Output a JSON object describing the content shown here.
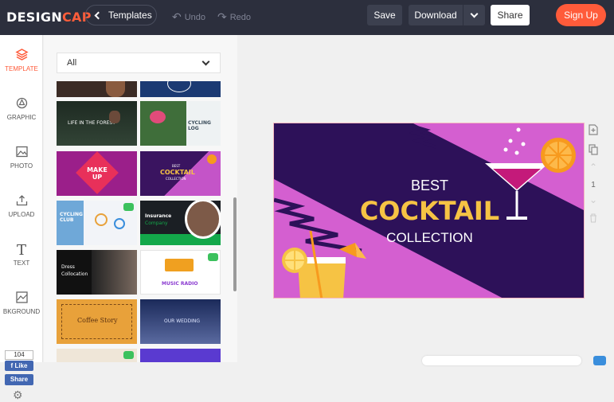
{
  "app": {
    "logo_design": "DESIGN",
    "logo_cap": "CAP"
  },
  "toolbar": {
    "templates_label": "Templates",
    "undo_label": "Undo",
    "redo_label": "Redo",
    "save_label": "Save",
    "download_label": "Download",
    "share_label": "Share",
    "signup_label": "Sign Up"
  },
  "sidebar": {
    "items": [
      {
        "label": "TEMPLATE",
        "icon": "layers-icon",
        "active": true
      },
      {
        "label": "GRAPHIC",
        "icon": "shapes-icon"
      },
      {
        "label": "PHOTO",
        "icon": "image-icon"
      },
      {
        "label": "UPLOAD",
        "icon": "upload-icon"
      },
      {
        "label": "TEXT",
        "icon": "text-icon"
      },
      {
        "label": "BKGROUND",
        "icon": "background-icon"
      }
    ],
    "fb_count": "104",
    "fb_like": "Like",
    "fb_share": "Share"
  },
  "panel": {
    "filter_value": "All",
    "thumbnails": [
      {
        "title": "LIFE IN THE FOREST"
      },
      {
        "title": "CYCLING LOG"
      },
      {
        "title": "MAKE UP"
      },
      {
        "title_top": "BEST",
        "title_main": "COCKTAIL",
        "title_bottom": "COLLECTION"
      },
      {
        "title": "CYCLING CLUB"
      },
      {
        "title_top": "Insurance",
        "title_bottom": "Company"
      },
      {
        "title_top": "Dress",
        "title_bottom": "Collocation"
      },
      {
        "title": "MUSIC RADIO"
      },
      {
        "title": "Coffee Story"
      },
      {
        "title": "OUR WEDDING"
      }
    ]
  },
  "design": {
    "line1": "BEST",
    "line2": "COCKTAIL",
    "line3": "COLLECTION",
    "colors": {
      "pink": "#d45fd0",
      "purple": "#2d1159",
      "yellow": "#f6c344",
      "orange": "#f79a1e"
    }
  },
  "right_tools": {
    "page_number": "1"
  }
}
